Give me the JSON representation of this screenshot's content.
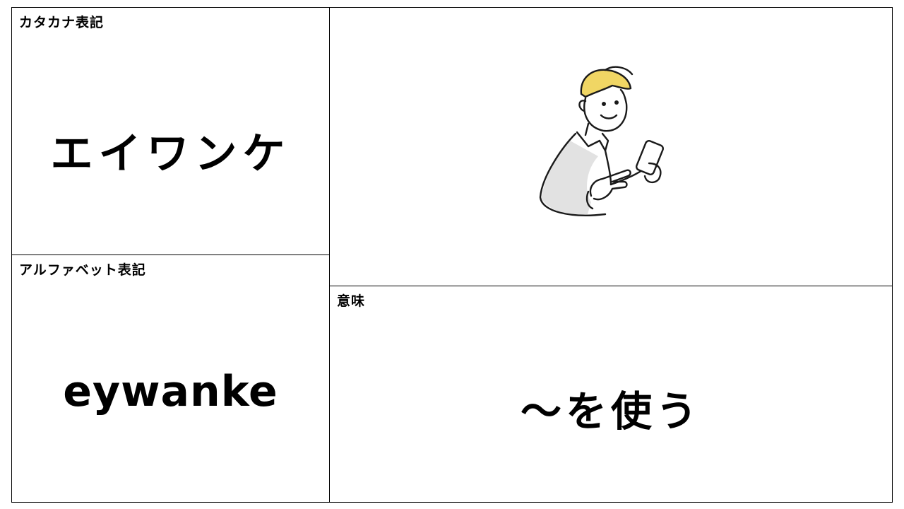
{
  "katakana": {
    "label": "カタカナ表記",
    "value": "エイワンケ"
  },
  "alphabet": {
    "label": "アルファベット表記",
    "value": "eywanke"
  },
  "meaning": {
    "label": "意味",
    "value": "～を使う"
  },
  "illustration": {
    "icon": "person-using-smartphone-icon",
    "hair_color": "#f0d664",
    "shadow_color": "#e2e2e2"
  }
}
